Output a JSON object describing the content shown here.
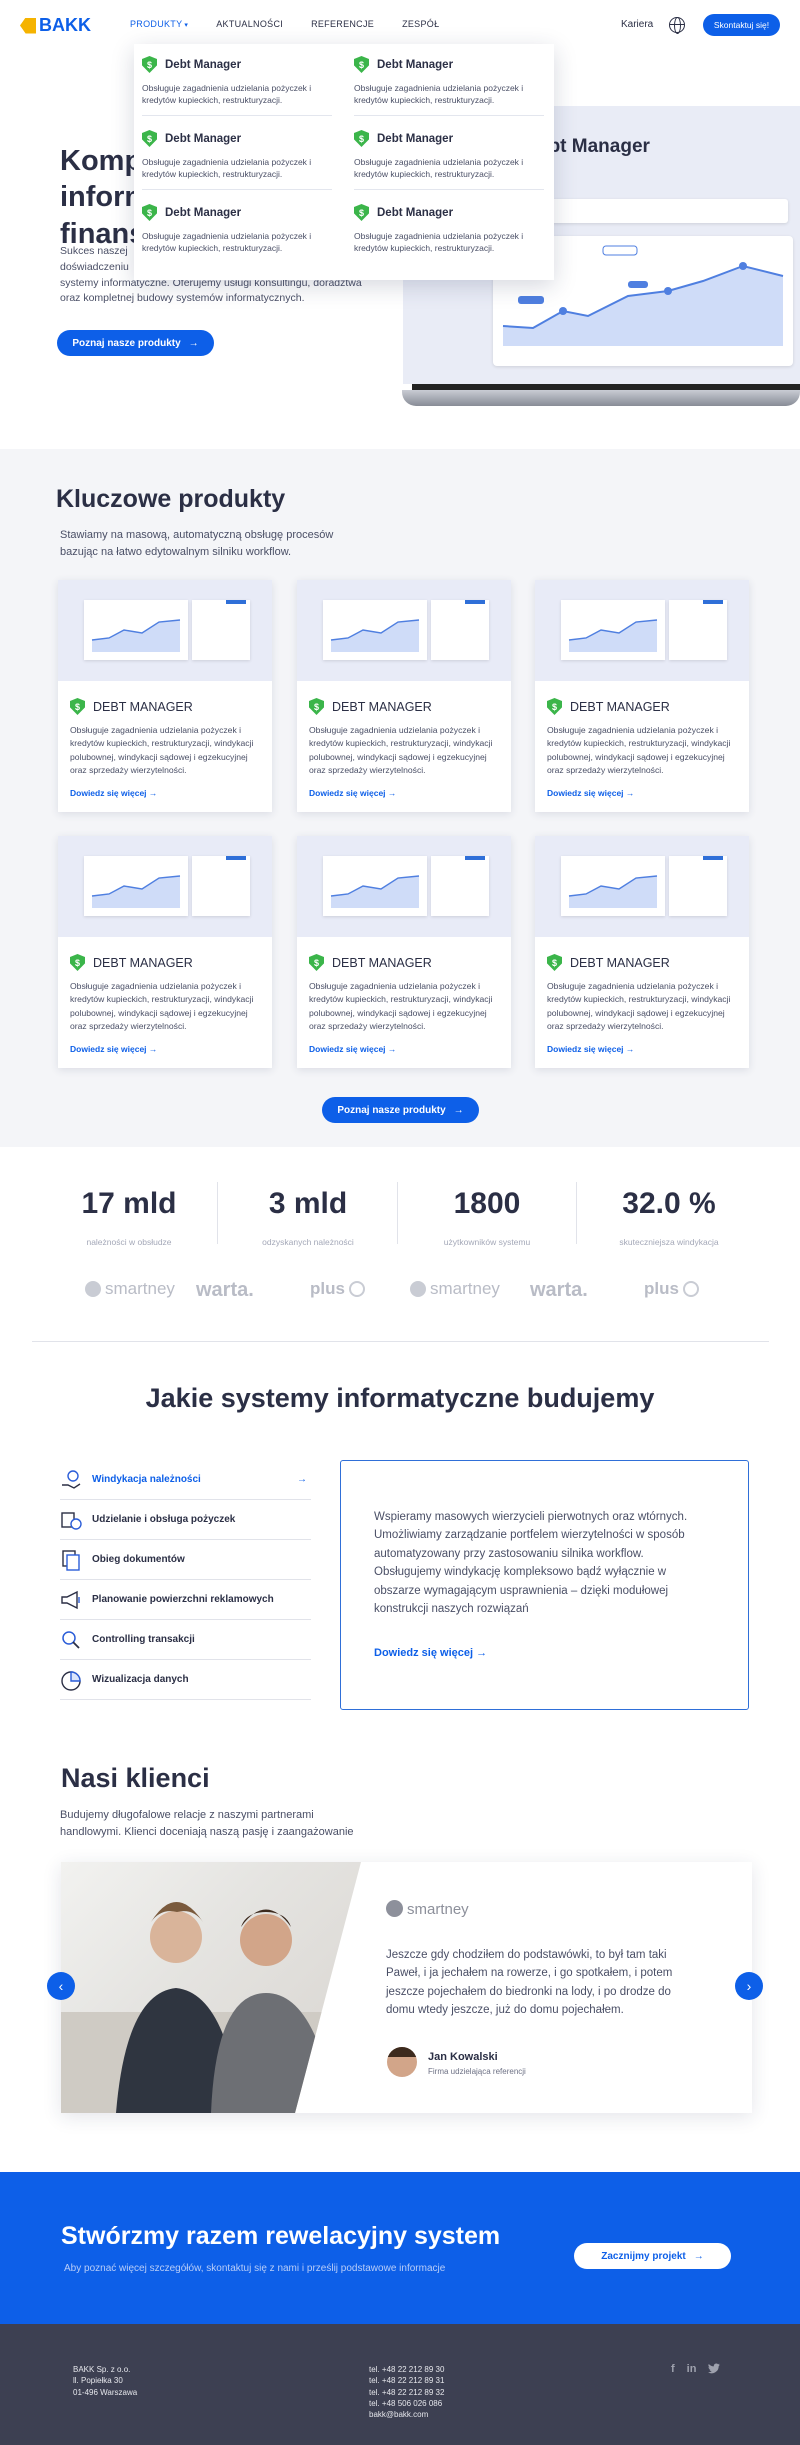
{
  "header": {
    "logo": "BAKK",
    "nav": [
      "PRODUKTY",
      "AKTUALNOŚCI",
      "REFERENCJE",
      "ZESPÓŁ"
    ],
    "kariera": "Kariera",
    "contact": "Skontaktuj się!"
  },
  "dropdown": {
    "items": [
      {
        "title": "Debt Manager",
        "desc": "Obsługuje zagadnienia udzielania pożyczek i kredytów kupieckich, restrukturyzacji."
      },
      {
        "title": "Debt Manager",
        "desc": "Obsługuje zagadnienia udzielania pożyczek i kredytów kupieckich, restrukturyzacji."
      },
      {
        "title": "Debt Manager",
        "desc": "Obsługuje zagadnienia udzielania pożyczek i kredytów kupieckich, restrukturyzacji."
      },
      {
        "title": "Debt Manager",
        "desc": "Obsługuje zagadnienia udzielania pożyczek i kredytów kupieckich, restrukturyzacji."
      },
      {
        "title": "Debt Manager",
        "desc": "Obsługuje zagadnienia udzielania pożyczek i kredytów kupieckich, restrukturyzacji."
      },
      {
        "title": "Debt Manager",
        "desc": "Obsługuje zagadnienia udzielania pożyczek i kredytów kupieckich, restrukturyzacji."
      }
    ]
  },
  "hero": {
    "title_l1": "Kompl",
    "title_l2": "inform",
    "title_l3": "finans",
    "text_l1": "Sukces naszej",
    "text_l2": "doświadczeniu",
    "text_l3": "systemy informatyczne. Oferujemy usługi konsultingu, doradztwa",
    "text_l4": "oraz kompletnej budowy systemów informatycznych.",
    "button": "Poznaj nasze produkty",
    "screen_title": "ebt Manager"
  },
  "products": {
    "title": "Kluczowe produkty",
    "desc_l1": "Stawiamy na masową, automatyczną obsługę procesów",
    "desc_l2": "bazując na łatwo edytowalnym silniku workflow.",
    "button": "Poznaj nasze produkty",
    "cards": [
      {
        "title": "DEBT MANAGER",
        "desc": "Obsługuje zagadnienia udzielania pożyczek i kredytów kupieckich, restrukturyzacji, windykacji polubownej, windykacji sądowej i egzekucyjnej oraz sprzedaży wierzytelności.",
        "link": "Dowiedz się więcej"
      },
      {
        "title": "DEBT MANAGER",
        "desc": "Obsługuje zagadnienia udzielania pożyczek i kredytów kupieckich, restrukturyzacji, windykacji polubownej, windykacji sądowej i egzekucyjnej oraz sprzedaży wierzytelności.",
        "link": "Dowiedz się więcej"
      },
      {
        "title": "DEBT MANAGER",
        "desc": "Obsługuje zagadnienia udzielania pożyczek i kredytów kupieckich, restrukturyzacji, windykacji polubownej, windykacji sądowej i egzekucyjnej oraz sprzedaży wierzytelności.",
        "link": "Dowiedz się więcej"
      },
      {
        "title": "DEBT MANAGER",
        "desc": "Obsługuje zagadnienia udzielania pożyczek i kredytów kupieckich, restrukturyzacji, windykacji polubownej, windykacji sądowej i egzekucyjnej oraz sprzedaży wierzytelności.",
        "link": "Dowiedz się więcej"
      },
      {
        "title": "DEBT MANAGER",
        "desc": "Obsługuje zagadnienia udzielania pożyczek i kredytów kupieckich, restrukturyzacji, windykacji polubownej, windykacji sądowej i egzekucyjnej oraz sprzedaży wierzytelności.",
        "link": "Dowiedz się więcej"
      },
      {
        "title": "DEBT MANAGER",
        "desc": "Obsługuje zagadnienia udzielania pożyczek i kredytów kupieckich, restrukturyzacji, windykacji polubownej, windykacji sądowej i egzekucyjnej oraz sprzedaży wierzytelności.",
        "link": "Dowiedz się więcej"
      }
    ]
  },
  "stats": [
    {
      "value": "17 mld",
      "label": "należności w obsłudze"
    },
    {
      "value": "3 mld",
      "label": "odzyskanych należności"
    },
    {
      "value": "1800",
      "label": "użytkowników systemu"
    },
    {
      "value": "32.0 %",
      "label": "skuteczniejsza windykacja"
    }
  ],
  "logos": [
    "smartney",
    "warta.",
    "plus",
    "smartney",
    "warta.",
    "plus"
  ],
  "systems": {
    "title": "Jakie systemy informatyczne budujemy",
    "items": [
      "Windykacja należności",
      "Udzielanie i obsługa pożyczek",
      "Obieg dokumentów",
      "Planowanie powierzchni reklamowych",
      "Controlling transakcji",
      "Wizualizacja danych"
    ],
    "text_l1": "Wspieramy masowych wierzycieli pierwotnych oraz wtórnych.",
    "text_l2": "Umożliwiamy zarządzanie portfelem wierzytelności w sposób",
    "text_l3": "automatyzowany przy zastosowaniu silnika workflow.",
    "text_l4": "Obsługujemy windykację kompleksowo bądź wyłącznie w",
    "text_l5": "obszarze wymagającym usprawnienia – dzięki modułowej",
    "text_l6": "konstrukcji naszych rozwiązań",
    "link": "Dowiedz się więcej"
  },
  "clients": {
    "title": "Nasi klienci",
    "desc_l1": "Budujemy długofalowe relacje z naszymi partnerami",
    "desc_l2": "handlowymi. Klienci doceniają naszą pasję i zaangażowanie",
    "logo": "smartney",
    "quote_l1": "Jeszcze gdy chodziłem do podstawówki, to był tam taki",
    "quote_l2": "Paweł, i ja jechałem na rowerze, i go spotkałem, i potem",
    "quote_l3": "jeszcze pojechałem do biedronki na lody, i po drodze do",
    "quote_l4": "domu wtedy jeszcze, już do domu pojechałem.",
    "person": "Jan Kowalski",
    "role": "Firma udzielająca referencji"
  },
  "cta": {
    "title": "Stwórzmy razem rewelacyjny system",
    "desc": "Aby poznać więcej szczegółów, skontaktuj się z nami i prześlij podstawowe informacje",
    "button": "Zacznijmy projekt"
  },
  "footer": {
    "addr_l1": "BAKK Sp. z o.o.",
    "addr_l2": "ll. Popiełka 30",
    "addr_l3": "01-496 Warszawa",
    "tel1": "tel. +48 22 212 89 30",
    "tel2": "tel. +48 22 212 89 31",
    "tel3": "tel. +48 22 212 89 32",
    "tel4": "tel. +48 506 026 086",
    "email": "bakk@bakk.com"
  },
  "colors": {
    "accent": "#0d5fe8",
    "green": "#3bb54a",
    "dark": "#2b2f45",
    "footer": "#3d4052"
  }
}
